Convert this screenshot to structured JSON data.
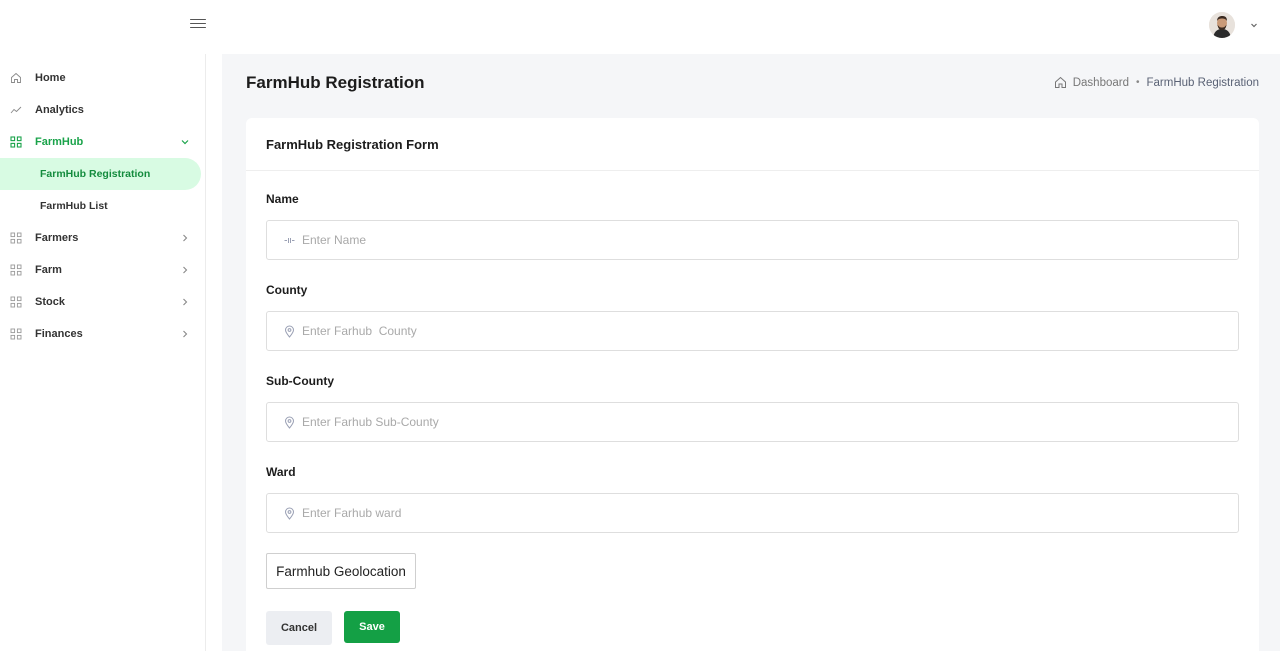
{
  "colors": {
    "accent": "#14a045",
    "active_bg": "#d8fbe3",
    "page_bg": "#f5f6f8"
  },
  "topbar": {
    "menu_icon": "hamburger-icon",
    "user_avatar": "user-avatar",
    "user_menu_icon": "chevron-down-icon"
  },
  "sidebar": {
    "items": [
      {
        "label": "Home",
        "icon": "home-icon"
      },
      {
        "label": "Analytics",
        "icon": "trend-line-icon"
      },
      {
        "label": "FarmHub",
        "icon": "grid-icon",
        "expanded": true
      },
      {
        "label": "Farmers",
        "icon": "grid-icon"
      },
      {
        "label": "Farm",
        "icon": "grid-icon"
      },
      {
        "label": "Stock",
        "icon": "grid-icon"
      },
      {
        "label": "Finances",
        "icon": "grid-icon"
      }
    ],
    "farmhub_sub": [
      {
        "label": "FarmHub Registration",
        "active": true
      },
      {
        "label": "FarmHub List",
        "active": false
      }
    ]
  },
  "page": {
    "title": "FarmHub Registration",
    "breadcrumb": {
      "home": "Dashboard",
      "separator": "•",
      "current": "FarmHub Registration"
    }
  },
  "form": {
    "title": "FarmHub Registration Form",
    "fields": [
      {
        "label": "Name",
        "placeholder": "Enter Name",
        "value": "",
        "icon": "name-input-icon"
      },
      {
        "label": "County",
        "placeholder": "Enter Farhub  County",
        "value": "",
        "icon": "location-pin-icon"
      },
      {
        "label": "Sub-County",
        "placeholder": "Enter Farhub Sub-County",
        "value": "",
        "icon": "location-pin-icon"
      },
      {
        "label": "Ward",
        "placeholder": "Enter Farhub ward",
        "value": "",
        "icon": "location-pin-icon"
      }
    ],
    "geolocation_label": "Farmhub Geolocation",
    "cancel_label": "Cancel",
    "save_label": "Save"
  }
}
